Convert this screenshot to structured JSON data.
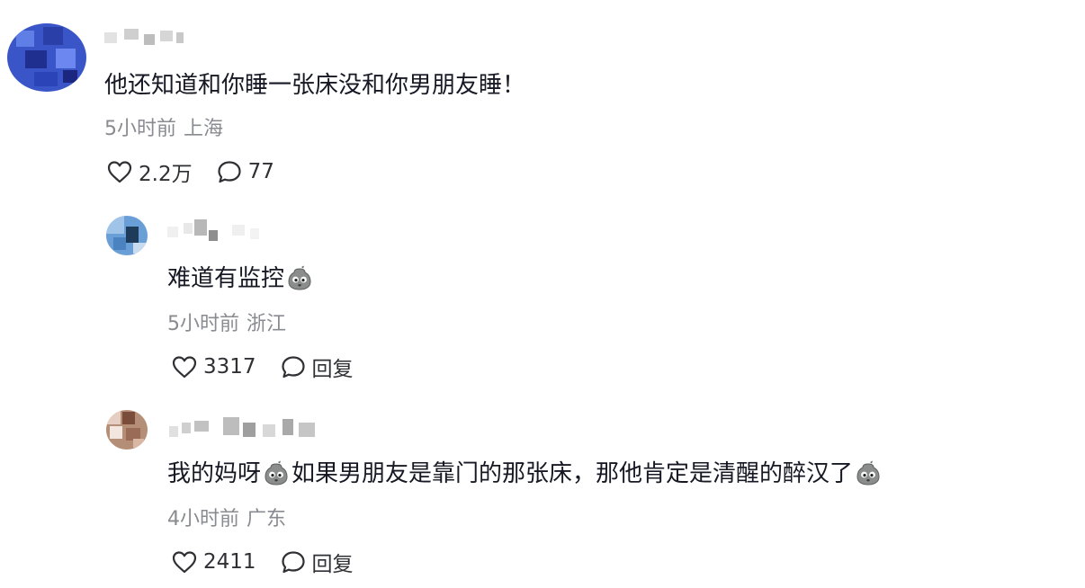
{
  "comments": [
    {
      "segments": [
        "他还知道和你睡一张床没和你男朋友睡！"
      ],
      "time": "5小时前",
      "location": "上海",
      "likes": "2.2万",
      "replies": "77"
    },
    {
      "segments": [
        "难道有监控"
      ],
      "time": "5小时前",
      "location": "浙江",
      "likes": "3317",
      "reply_label": "回复"
    },
    {
      "segments": [
        "我的妈呀",
        "如果男朋友是靠门的那张床，那他肯定是清醒的醉汉了"
      ],
      "time": "4小时前",
      "location": "广东",
      "likes": "2411",
      "reply_label": "回复"
    }
  ],
  "icons": {
    "like": "heart-outline-icon",
    "comment": "speech-bubble-icon",
    "emoji": "wronged-face-emoji-icon"
  },
  "colors": {
    "text": "#161823",
    "meta": "#8a8b91",
    "action": "#2f3034"
  }
}
